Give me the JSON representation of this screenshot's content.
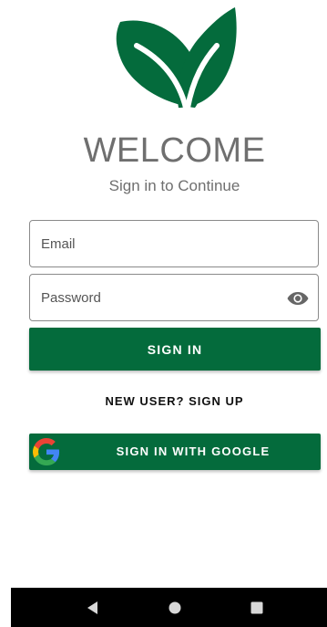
{
  "header": {
    "logo_icon": "leaf-logo-icon",
    "title": "WELCOME",
    "subtitle": "Sign in to Continue"
  },
  "form": {
    "email": {
      "placeholder": "Email",
      "value": ""
    },
    "password": {
      "placeholder": "Password",
      "value": "",
      "toggle_icon": "eye-icon"
    },
    "sign_in_label": "SIGN IN",
    "sign_up_label": "NEW USER? SIGN UP",
    "google_label": "SIGN IN WITH GOOGLE",
    "google_icon": "google-g-icon"
  },
  "navbar": {
    "back_icon": "back-triangle-icon",
    "home_icon": "home-circle-icon",
    "recents_icon": "recents-square-icon"
  },
  "colors": {
    "brand_green": "#046b3c",
    "text_gray": "#6f6f6f",
    "navbar": "#000000"
  }
}
